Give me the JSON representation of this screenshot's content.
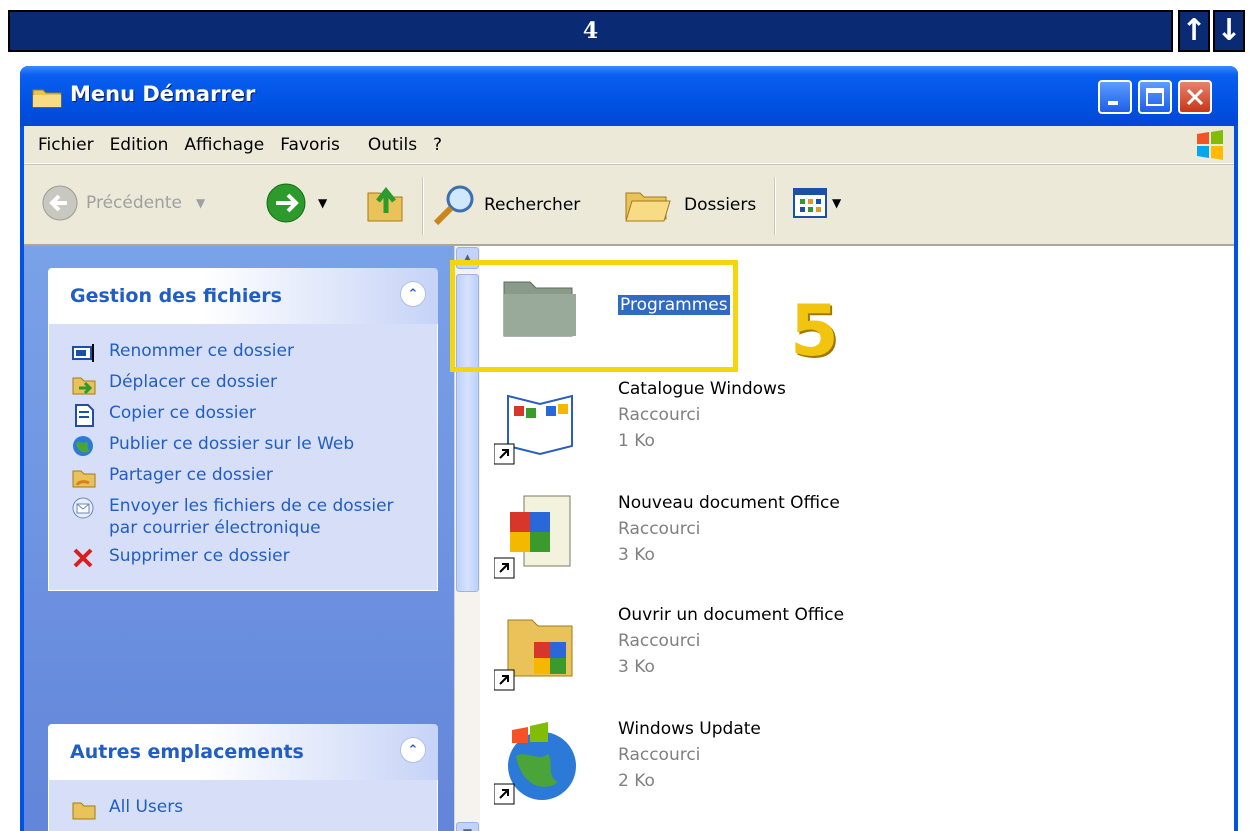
{
  "tutorial": {
    "step_label": "4",
    "step_callout": "5",
    "arrow_up": "↑",
    "arrow_down": "↓"
  },
  "window": {
    "title": "Menu Démarrer"
  },
  "menu": {
    "items": [
      "Fichier",
      "Edition",
      "Affichage",
      "Favoris",
      "Outils",
      "?"
    ]
  },
  "toolbar": {
    "back_label": "Précédente",
    "search_label": "Rechercher",
    "folders_label": "Dossiers"
  },
  "tasks_panel": {
    "title": "Gestion des fichiers",
    "items": [
      {
        "label": "Renommer ce dossier",
        "icon": "rename-icon"
      },
      {
        "label": "Déplacer ce dossier",
        "icon": "move-icon"
      },
      {
        "label": "Copier ce dossier",
        "icon": "copy-icon"
      },
      {
        "label": "Publier ce dossier sur le Web",
        "icon": "publish-web-icon"
      },
      {
        "label": "Partager ce dossier",
        "icon": "share-icon"
      },
      {
        "label": "Envoyer les fichiers de ce dossier par courrier électronique",
        "icon": "email-icon"
      },
      {
        "label": "Supprimer ce dossier",
        "icon": "delete-icon"
      }
    ]
  },
  "places_panel": {
    "title": "Autres emplacements",
    "items": [
      {
        "label": "All Users",
        "icon": "folder-icon"
      }
    ]
  },
  "files": [
    {
      "name": "Programmes",
      "type": "",
      "size": "",
      "icon": "folder-icon",
      "selected": true
    },
    {
      "name": "Catalogue Windows",
      "type": "Raccourci",
      "size": "1 Ko",
      "icon": "catalog-icon"
    },
    {
      "name": "Nouveau document Office",
      "type": "Raccourci",
      "size": "3 Ko",
      "icon": "new-office-doc-icon"
    },
    {
      "name": "Ouvrir un document Office",
      "type": "Raccourci",
      "size": "3 Ko",
      "icon": "open-office-doc-icon"
    },
    {
      "name": "Windows Update",
      "type": "Raccourci",
      "size": "2 Ko",
      "icon": "windows-update-icon"
    }
  ],
  "colors": {
    "highlight": "#f4d60c",
    "step_callout": "#f1c40f",
    "selection": "#316ac5",
    "titlebar": "#0054e3"
  }
}
